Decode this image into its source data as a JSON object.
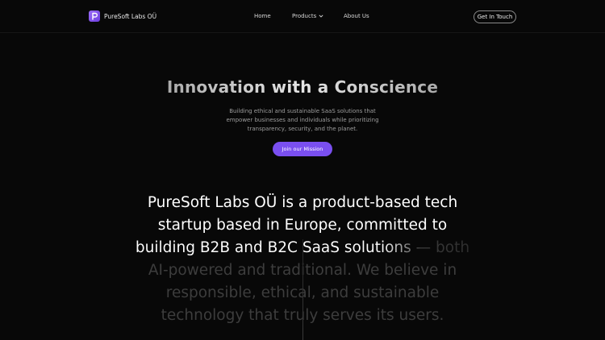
{
  "brand": {
    "name": "PureSoft Labs OÜ",
    "logo_icon": "p-logo-icon",
    "logo_color": "#7a4ff0"
  },
  "nav": {
    "items": [
      {
        "label": "Home"
      },
      {
        "label": "Products",
        "icon": "chevron-down-icon"
      },
      {
        "label": "About Us"
      }
    ],
    "cta_label": "Get In Touch"
  },
  "hero": {
    "title": "Innovation with a Conscience",
    "subtitle": "Building ethical and sustainable SaaS solutions that empower businesses and individuals while prioritizing transparency, security, and the planet.",
    "cta_label": "Join our Mission",
    "accent_color": "#7a4ff0"
  },
  "statement": {
    "lines": [
      "PureSoft Labs OÜ is a product-based tech",
      "startup based in Europe, committed to",
      "building B2B and B2C SaaS solutions — both",
      "AI-powered and traditional. We believe in",
      "responsible, ethical, and sustainable",
      "technology that truly serves its users."
    ]
  }
}
